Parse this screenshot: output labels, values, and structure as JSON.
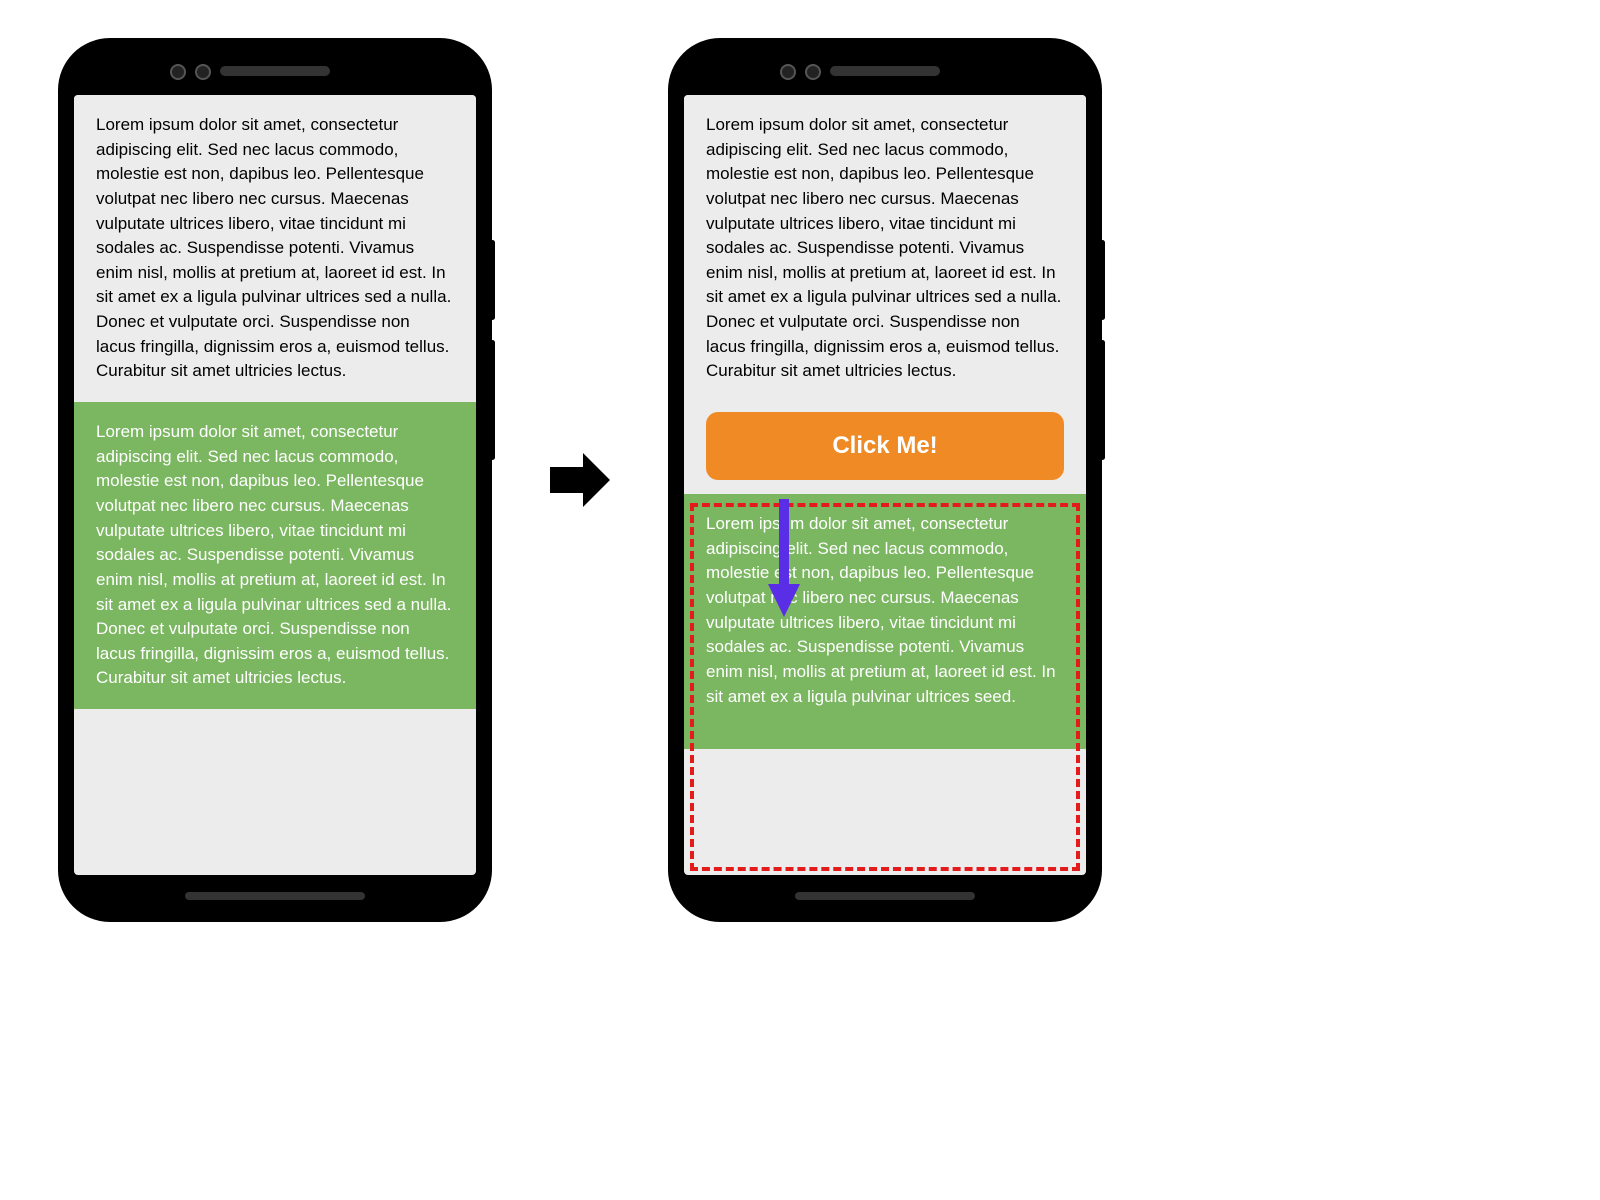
{
  "phone_left": {
    "paragraph_top": "Lorem ipsum dolor sit amet, consectetur adipiscing elit. Sed nec lacus commodo, molestie est non, dapibus leo. Pellentesque volutpat nec libero nec cursus. Maecenas vulputate ultrices libero, vitae tincidunt mi sodales ac. Suspendisse potenti. Vivamus enim nisl, mollis at pretium at, laoreet id est. In sit amet ex a ligula pulvinar ultrices sed a nulla. Donec et vulputate orci. Suspendisse non lacus fringilla, dignissim eros a, euismod tellus. Curabitur sit amet ultricies lectus.",
    "paragraph_bottom": "Lorem ipsum dolor sit amet, consectetur adipiscing elit. Sed nec lacus commodo, molestie est non, dapibus leo. Pellentesque volutpat nec libero nec cursus. Maecenas vulputate ultrices libero, vitae tincidunt mi sodales ac. Suspendisse potenti. Vivamus enim nisl, mollis at pretium at, laoreet id est. In sit amet ex a ligula pulvinar ultrices sed a nulla. Donec et vulputate orci. Suspendisse non lacus fringilla, dignissim eros a, euismod tellus. Curabitur sit amet ultricies lectus."
  },
  "phone_right": {
    "paragraph_top": "Lorem ipsum dolor sit amet, consectetur adipiscing elit. Sed nec lacus commodo, molestie est non, dapibus leo. Pellentesque volutpat nec libero nec cursus. Maecenas vulputate ultrices libero, vitae tincidunt mi sodales ac. Suspendisse potenti. Vivamus enim nisl, mollis at pretium at, laoreet id est. In sit amet ex a ligula pulvinar ultrices sed a nulla. Donec et vulputate orci. Suspendisse non lacus fringilla, dignissim eros a, euismod tellus. Curabitur sit amet ultricies lectus.",
    "button_label": "Click Me!",
    "paragraph_bottom": "Lorem ipsum dolor sit amet, consectetur adipiscing elit. Sed nec lacus commodo, molestie est non, dapibus leo. Pellentesque volutpat nec libero nec cursus. Maecenas vulputate ultrices libero, vitae tincidunt mi sodales ac. Suspendisse potenti. Vivamus enim nisl, mollis at pretium at, laoreet id est. In sit amet ex a ligula pulvinar ultrices seed."
  },
  "colors": {
    "screen_bg": "#ececec",
    "green_block": "#7bb661",
    "button_bg": "#f08a24",
    "dashed_border": "#e41b1b",
    "shift_arrow": "#5a2ee6"
  }
}
